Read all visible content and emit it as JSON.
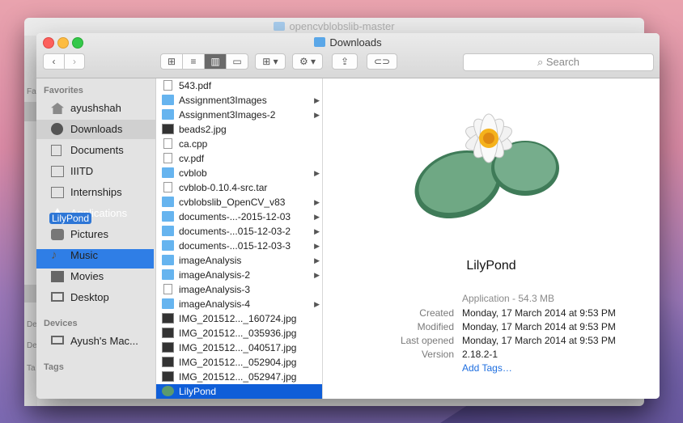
{
  "background_window": {
    "title": "opencvblobslib-master",
    "sidebar_fragments": [
      "Fa",
      "De",
      "De",
      "Ta"
    ]
  },
  "window": {
    "title": "Downloads"
  },
  "toolbar": {
    "search_placeholder": "Search"
  },
  "sidebar": {
    "favorites_label": "Favorites",
    "items": [
      {
        "label": "ayushshah",
        "icon": "home-icon"
      },
      {
        "label": "Downloads",
        "icon": "downloads-icon",
        "selected": true
      },
      {
        "label": "Documents",
        "icon": "documents-icon"
      },
      {
        "label": "IIITD",
        "icon": "folder-icon"
      },
      {
        "label": "Internships",
        "icon": "folder-icon"
      },
      {
        "label": "Applications",
        "icon": "applications-icon"
      },
      {
        "label": "Pictures",
        "icon": "camera-icon"
      },
      {
        "label": "Music",
        "icon": "music-icon"
      },
      {
        "label": "Movies",
        "icon": "film-icon"
      },
      {
        "label": "Desktop",
        "icon": "desktop-icon"
      }
    ],
    "devices_label": "Devices",
    "devices": [
      {
        "label": "Ayush's Mac...",
        "icon": "laptop-icon"
      }
    ],
    "tags_label": "Tags",
    "drag_ghost_label": "LilyPond"
  },
  "files": [
    {
      "name": "543.pdf",
      "type": "pdf"
    },
    {
      "name": "Assignment3Images",
      "type": "folder"
    },
    {
      "name": "Assignment3Images-2",
      "type": "folder"
    },
    {
      "name": "beads2.jpg",
      "type": "image"
    },
    {
      "name": "ca.cpp",
      "type": "code"
    },
    {
      "name": "cv.pdf",
      "type": "pdf"
    },
    {
      "name": "cvblob",
      "type": "folder"
    },
    {
      "name": "cvblob-0.10.4-src.tar",
      "type": "archive"
    },
    {
      "name": "cvblobslib_OpenCV_v83",
      "type": "folder"
    },
    {
      "name": "documents-...-2015-12-03",
      "type": "folder"
    },
    {
      "name": "documents-...015-12-03-2",
      "type": "folder"
    },
    {
      "name": "documents-...015-12-03-3",
      "type": "folder"
    },
    {
      "name": "imageAnalysis",
      "type": "folder"
    },
    {
      "name": "imageAnalysis-2",
      "type": "folder"
    },
    {
      "name": "imageAnalysis-3",
      "type": "doc"
    },
    {
      "name": "imageAnalysis-4",
      "type": "folder"
    },
    {
      "name": "IMG_201512..._160724.jpg",
      "type": "image"
    },
    {
      "name": "IMG_201512..._035936.jpg",
      "type": "image"
    },
    {
      "name": "IMG_201512..._040517.jpg",
      "type": "image"
    },
    {
      "name": "IMG_201512..._052904.jpg",
      "type": "image"
    },
    {
      "name": "IMG_201512..._052947.jpg",
      "type": "image"
    },
    {
      "name": "LilyPond",
      "type": "app",
      "selected": true
    }
  ],
  "preview": {
    "name": "LilyPond",
    "kind": "Application - 54.3 MB",
    "created_label": "Created",
    "created": "Monday, 17 March 2014 at 9:53 PM",
    "modified_label": "Modified",
    "modified": "Monday, 17 March 2014 at 9:53 PM",
    "opened_label": "Last opened",
    "opened": "Monday, 17 March 2014 at 9:53 PM",
    "version_label": "Version",
    "version": "2.18.2-1",
    "tags_link": "Add Tags…"
  }
}
